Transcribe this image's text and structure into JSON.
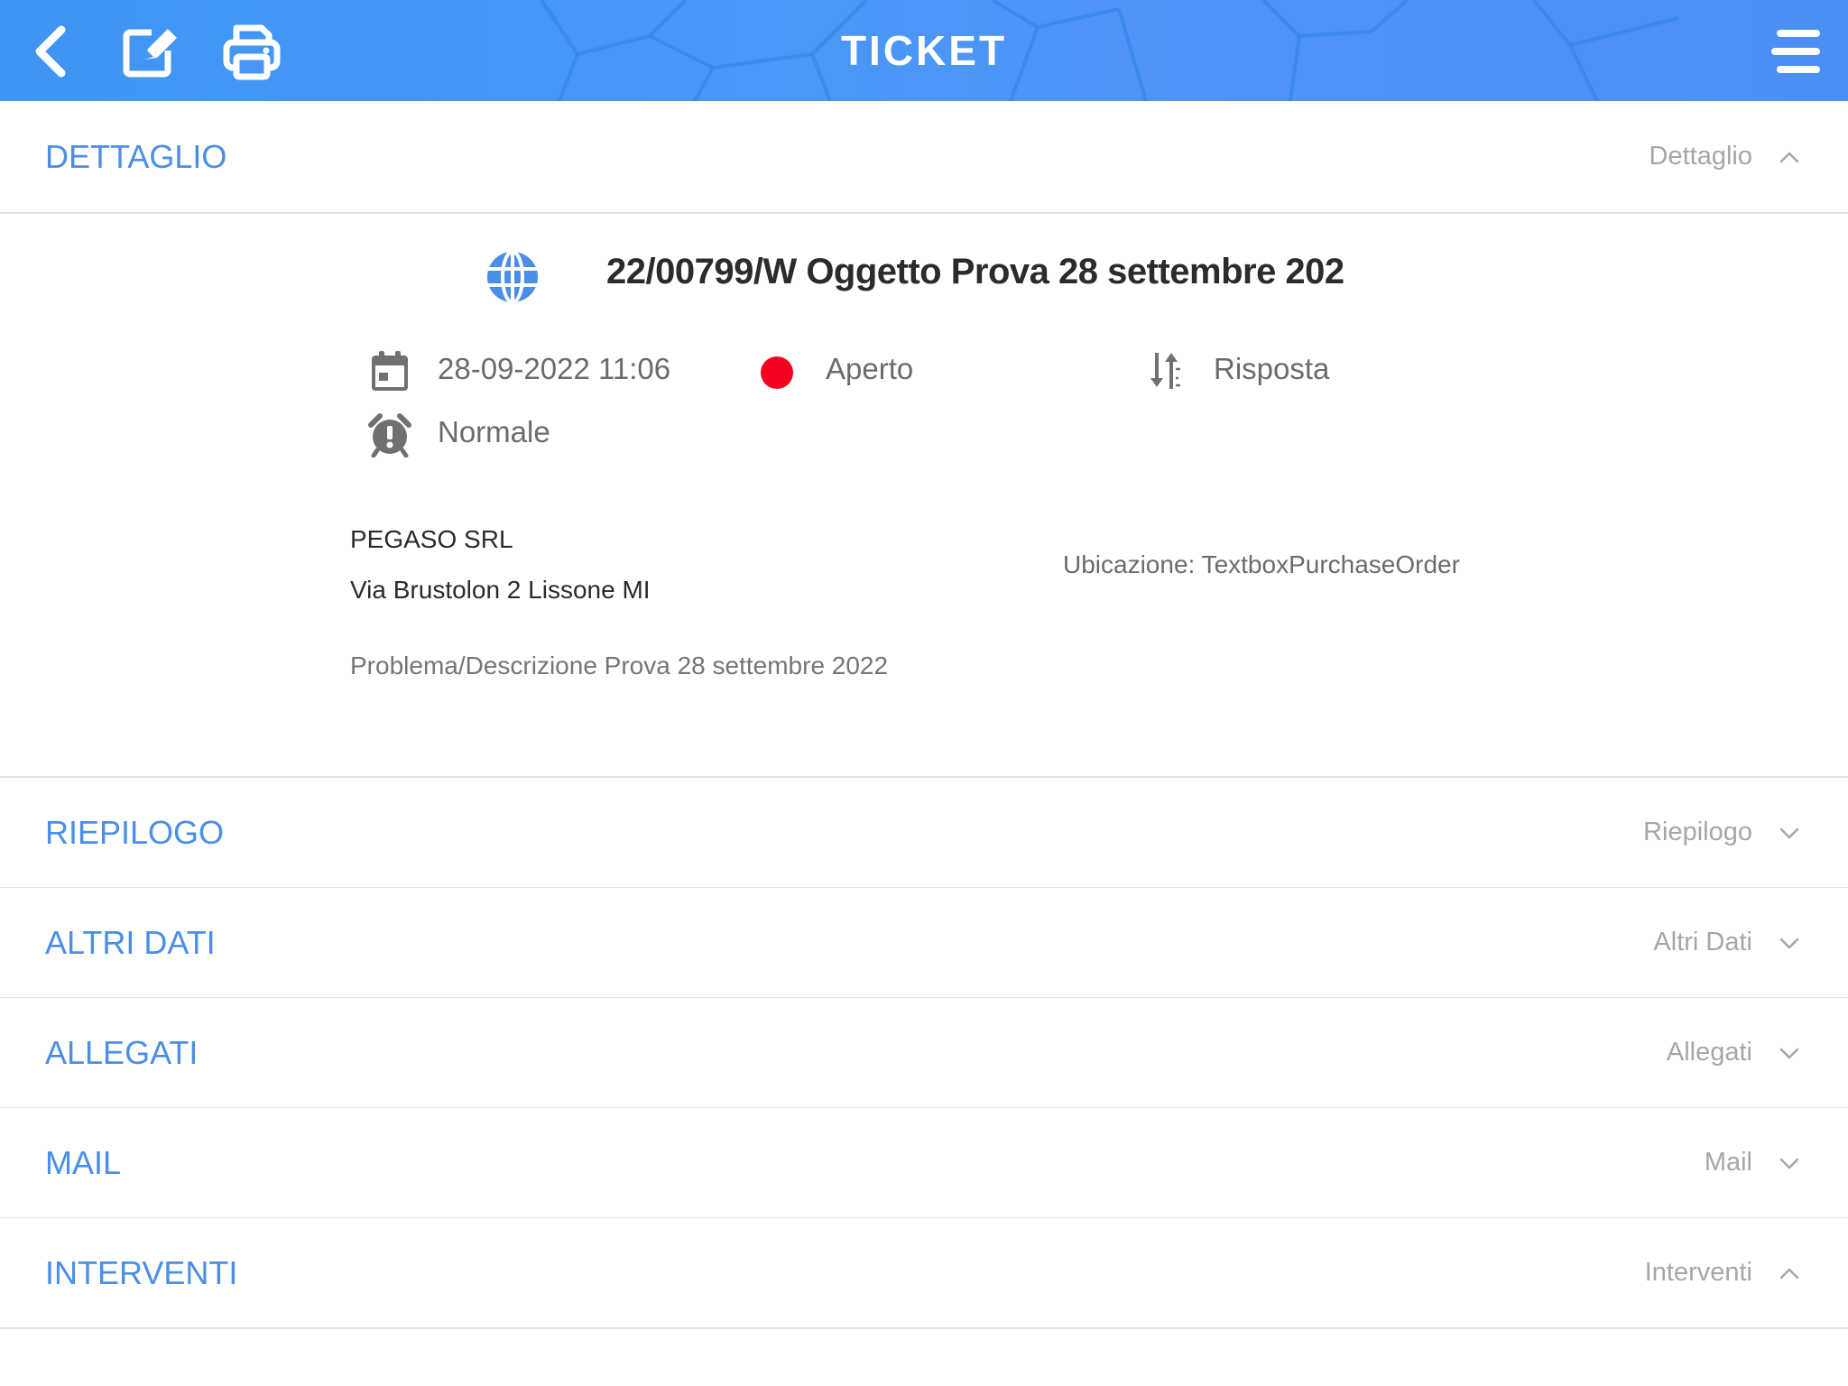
{
  "header": {
    "title": "TICKET",
    "back_icon": "chevron-left-icon",
    "edit_icon": "edit-icon",
    "print_icon": "print-icon",
    "menu_icon": "menu-icon",
    "background_color": "#4a95f5"
  },
  "sections": [
    {
      "id": "dettaglio",
      "title": "DETTAGLIO",
      "subtitle": "Dettaglio",
      "expanded": true
    },
    {
      "id": "riepilogo",
      "title": "RIEPILOGO",
      "subtitle": "Riepilogo",
      "expanded": false
    },
    {
      "id": "altri-dati",
      "title": "ALTRI DATI",
      "subtitle": "Altri Dati",
      "expanded": false
    },
    {
      "id": "allegati",
      "title": "ALLEGATI",
      "subtitle": "Allegati",
      "expanded": false
    },
    {
      "id": "mail",
      "title": "MAIL",
      "subtitle": "Mail",
      "expanded": false
    },
    {
      "id": "interventi",
      "title": "INTERVENTI",
      "subtitle": "Interventi",
      "expanded": true
    }
  ],
  "detail": {
    "source_icon": "globe-icon",
    "title": "22/00799/W Oggetto Prova 28 settembre 202",
    "date": "28-09-2022 11:06",
    "status": "Aperto",
    "status_color": "#f5001e",
    "direction": "Risposta",
    "priority": "Normale",
    "company": "PEGASO SRL",
    "address": "Via Brustolon 2 Lissone MI",
    "location": "Ubicazione: TextboxPurchaseOrder",
    "description": "Problema/Descrizione Prova 28 settembre 2022"
  },
  "colors": {
    "accent": "#4a8ee8",
    "subtitle": "#a6a6a6",
    "divider": "#e3e3e3"
  }
}
